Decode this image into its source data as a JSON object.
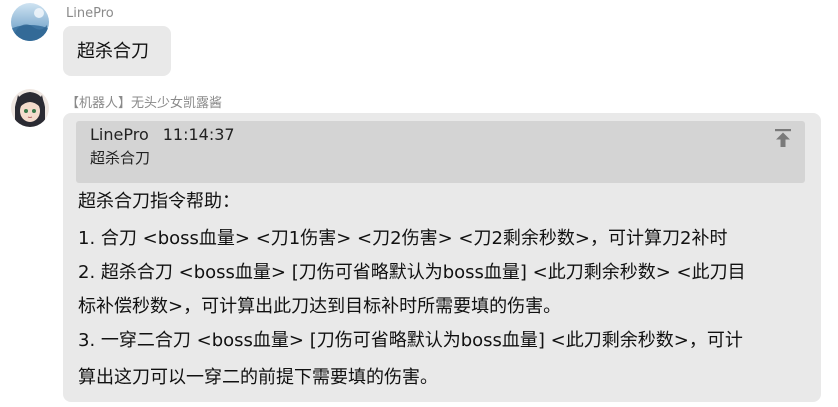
{
  "messages": [
    {
      "sender": "LinePro",
      "text": "超杀合刀"
    },
    {
      "sender": "【机器人】无头少女凯露酱",
      "quote": {
        "author": "LinePro",
        "time": "11:14:37",
        "text": "超杀合刀",
        "icon": "pin-to-top-icon"
      },
      "lines": [
        "超杀合刀指令帮助：",
        "1. 合刀 <boss血量> <刀1伤害> <刀2伤害> <刀2剩余秒数>，可计算刀2补时",
        "2. 超杀合刀 <boss血量> [刀伤可省略默认为boss血量] <此刀剩余秒数> <此刀目",
        "标补偿秒数>，可计算出此刀达到目标补时所需要填的伤害。",
        "3. 一穿二合刀  <boss血量> [刀伤可省略默认为boss血量] <此刀剩余秒数>，可计",
        "算出这刀可以一穿二的前提下需要填的伤害。"
      ]
    }
  ],
  "colors": {
    "bubble": "#e9e9e9",
    "quote": "#d4d4d4",
    "sender": "#8a8a8a"
  }
}
